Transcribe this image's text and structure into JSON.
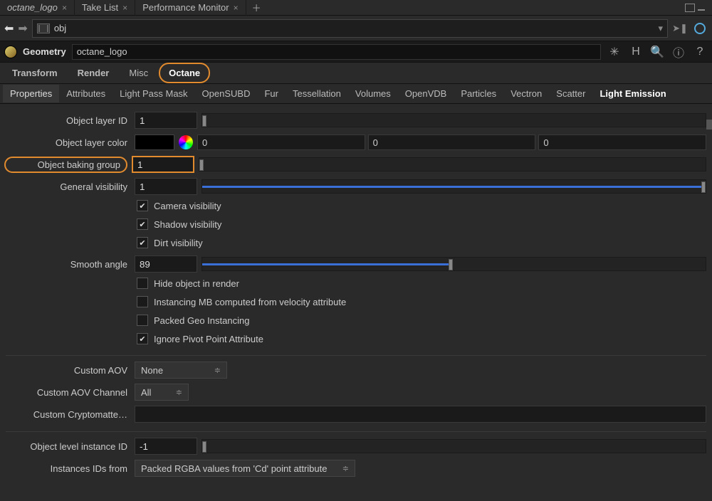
{
  "tabs": [
    "octane_logo",
    "Take List",
    "Performance Monitor"
  ],
  "path": "obj",
  "geo": {
    "label": "Geometry",
    "name": "octane_logo"
  },
  "maintabs": [
    "Transform",
    "Render",
    "Misc",
    "Octane"
  ],
  "subtabs": [
    "Properties",
    "Attributes",
    "Light Pass Mask",
    "OpenSUBD",
    "Fur",
    "Tessellation",
    "Volumes",
    "OpenVDB",
    "Particles",
    "Vectron",
    "Scatter",
    "Light Emission"
  ],
  "objectLayerId": {
    "label": "Object layer ID",
    "value": "1"
  },
  "objectLayerColor": {
    "label": "Object layer color",
    "r": "0",
    "g": "0",
    "b": "0"
  },
  "objectBakingGroup": {
    "label": "Object baking group",
    "value": "1"
  },
  "generalVisibility": {
    "label": "General visibility",
    "value": "1"
  },
  "checks": {
    "camera": "Camera visibility",
    "shadow": "Shadow visibility",
    "dirt": "Dirt visibility",
    "hide": "Hide object in render",
    "instMB": "Instancing MB computed from velocity attribute",
    "packed": "Packed Geo Instancing",
    "ignorePivot": "Ignore Pivot Point Attribute"
  },
  "smoothAngle": {
    "label": "Smooth angle",
    "value": "89"
  },
  "customAov": {
    "label": "Custom AOV",
    "value": "None"
  },
  "customAovCh": {
    "label": "Custom AOV Channel",
    "value": "All"
  },
  "customCrypto": {
    "label": "Custom Cryptomatte…",
    "value": ""
  },
  "instanceId": {
    "label": "Object level instance ID",
    "value": "-1"
  },
  "instancesFrom": {
    "label": "Instances IDs from",
    "value": "Packed RGBA values from 'Cd' point attribute"
  }
}
